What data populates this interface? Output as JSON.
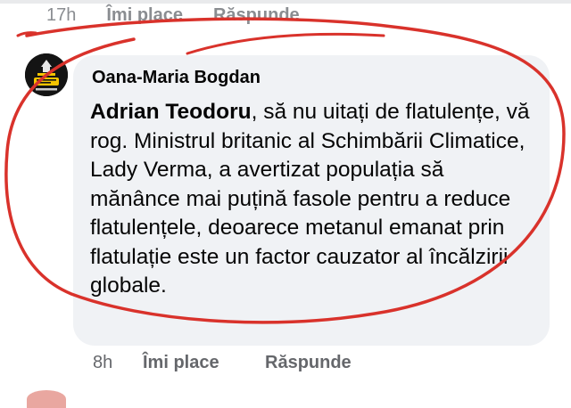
{
  "previous_comment": {
    "time": "17h",
    "like_label": "Îmi place",
    "reply_label": "Răspunde"
  },
  "comment": {
    "author": "Oana-Maria Bogdan",
    "mention": "Adrian Teodoru",
    "text": ", să nu uitați de flatulențe, vă rog. Ministrul britanic al Schimbării Climatice, Lady Verma, a avertizat populația să mănânce mai puțină fasole pentru a reduce flatulențele, deoarece metanul emanat prin flatulație este un factor cauzator al încălzirii globale.",
    "time": "8h",
    "like_label": "Îmi place",
    "reply_label": "Răspunde"
  },
  "colors": {
    "bubble": "#f0f2f5",
    "meta_text": "#65676b",
    "annotation_red": "#d9322b"
  }
}
